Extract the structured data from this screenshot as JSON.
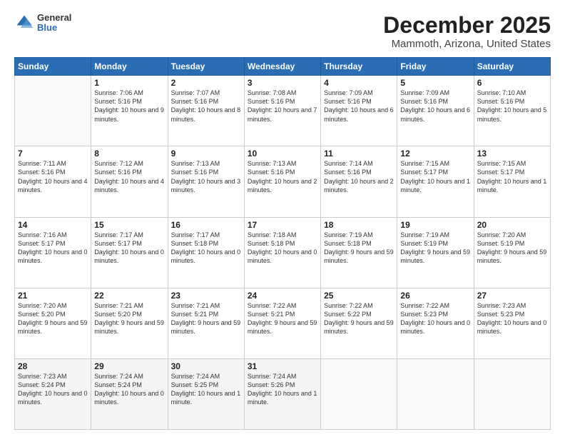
{
  "logo": {
    "general": "General",
    "blue": "Blue"
  },
  "title": "December 2025",
  "subtitle": "Mammoth, Arizona, United States",
  "days_header": [
    "Sunday",
    "Monday",
    "Tuesday",
    "Wednesday",
    "Thursday",
    "Friday",
    "Saturday"
  ],
  "weeks": [
    [
      {
        "num": "",
        "sunrise": "",
        "sunset": "",
        "daylight": ""
      },
      {
        "num": "1",
        "sunrise": "Sunrise: 7:06 AM",
        "sunset": "Sunset: 5:16 PM",
        "daylight": "Daylight: 10 hours and 9 minutes."
      },
      {
        "num": "2",
        "sunrise": "Sunrise: 7:07 AM",
        "sunset": "Sunset: 5:16 PM",
        "daylight": "Daylight: 10 hours and 8 minutes."
      },
      {
        "num": "3",
        "sunrise": "Sunrise: 7:08 AM",
        "sunset": "Sunset: 5:16 PM",
        "daylight": "Daylight: 10 hours and 7 minutes."
      },
      {
        "num": "4",
        "sunrise": "Sunrise: 7:09 AM",
        "sunset": "Sunset: 5:16 PM",
        "daylight": "Daylight: 10 hours and 6 minutes."
      },
      {
        "num": "5",
        "sunrise": "Sunrise: 7:09 AM",
        "sunset": "Sunset: 5:16 PM",
        "daylight": "Daylight: 10 hours and 6 minutes."
      },
      {
        "num": "6",
        "sunrise": "Sunrise: 7:10 AM",
        "sunset": "Sunset: 5:16 PM",
        "daylight": "Daylight: 10 hours and 5 minutes."
      }
    ],
    [
      {
        "num": "7",
        "sunrise": "Sunrise: 7:11 AM",
        "sunset": "Sunset: 5:16 PM",
        "daylight": "Daylight: 10 hours and 4 minutes."
      },
      {
        "num": "8",
        "sunrise": "Sunrise: 7:12 AM",
        "sunset": "Sunset: 5:16 PM",
        "daylight": "Daylight: 10 hours and 4 minutes."
      },
      {
        "num": "9",
        "sunrise": "Sunrise: 7:13 AM",
        "sunset": "Sunset: 5:16 PM",
        "daylight": "Daylight: 10 hours and 3 minutes."
      },
      {
        "num": "10",
        "sunrise": "Sunrise: 7:13 AM",
        "sunset": "Sunset: 5:16 PM",
        "daylight": "Daylight: 10 hours and 2 minutes."
      },
      {
        "num": "11",
        "sunrise": "Sunrise: 7:14 AM",
        "sunset": "Sunset: 5:16 PM",
        "daylight": "Daylight: 10 hours and 2 minutes."
      },
      {
        "num": "12",
        "sunrise": "Sunrise: 7:15 AM",
        "sunset": "Sunset: 5:17 PM",
        "daylight": "Daylight: 10 hours and 1 minute."
      },
      {
        "num": "13",
        "sunrise": "Sunrise: 7:15 AM",
        "sunset": "Sunset: 5:17 PM",
        "daylight": "Daylight: 10 hours and 1 minute."
      }
    ],
    [
      {
        "num": "14",
        "sunrise": "Sunrise: 7:16 AM",
        "sunset": "Sunset: 5:17 PM",
        "daylight": "Daylight: 10 hours and 0 minutes."
      },
      {
        "num": "15",
        "sunrise": "Sunrise: 7:17 AM",
        "sunset": "Sunset: 5:17 PM",
        "daylight": "Daylight: 10 hours and 0 minutes."
      },
      {
        "num": "16",
        "sunrise": "Sunrise: 7:17 AM",
        "sunset": "Sunset: 5:18 PM",
        "daylight": "Daylight: 10 hours and 0 minutes."
      },
      {
        "num": "17",
        "sunrise": "Sunrise: 7:18 AM",
        "sunset": "Sunset: 5:18 PM",
        "daylight": "Daylight: 10 hours and 0 minutes."
      },
      {
        "num": "18",
        "sunrise": "Sunrise: 7:19 AM",
        "sunset": "Sunset: 5:18 PM",
        "daylight": "Daylight: 9 hours and 59 minutes."
      },
      {
        "num": "19",
        "sunrise": "Sunrise: 7:19 AM",
        "sunset": "Sunset: 5:19 PM",
        "daylight": "Daylight: 9 hours and 59 minutes."
      },
      {
        "num": "20",
        "sunrise": "Sunrise: 7:20 AM",
        "sunset": "Sunset: 5:19 PM",
        "daylight": "Daylight: 9 hours and 59 minutes."
      }
    ],
    [
      {
        "num": "21",
        "sunrise": "Sunrise: 7:20 AM",
        "sunset": "Sunset: 5:20 PM",
        "daylight": "Daylight: 9 hours and 59 minutes."
      },
      {
        "num": "22",
        "sunrise": "Sunrise: 7:21 AM",
        "sunset": "Sunset: 5:20 PM",
        "daylight": "Daylight: 9 hours and 59 minutes."
      },
      {
        "num": "23",
        "sunrise": "Sunrise: 7:21 AM",
        "sunset": "Sunset: 5:21 PM",
        "daylight": "Daylight: 9 hours and 59 minutes."
      },
      {
        "num": "24",
        "sunrise": "Sunrise: 7:22 AM",
        "sunset": "Sunset: 5:21 PM",
        "daylight": "Daylight: 9 hours and 59 minutes."
      },
      {
        "num": "25",
        "sunrise": "Sunrise: 7:22 AM",
        "sunset": "Sunset: 5:22 PM",
        "daylight": "Daylight: 9 hours and 59 minutes."
      },
      {
        "num": "26",
        "sunrise": "Sunrise: 7:22 AM",
        "sunset": "Sunset: 5:23 PM",
        "daylight": "Daylight: 10 hours and 0 minutes."
      },
      {
        "num": "27",
        "sunrise": "Sunrise: 7:23 AM",
        "sunset": "Sunset: 5:23 PM",
        "daylight": "Daylight: 10 hours and 0 minutes."
      }
    ],
    [
      {
        "num": "28",
        "sunrise": "Sunrise: 7:23 AM",
        "sunset": "Sunset: 5:24 PM",
        "daylight": "Daylight: 10 hours and 0 minutes."
      },
      {
        "num": "29",
        "sunrise": "Sunrise: 7:24 AM",
        "sunset": "Sunset: 5:24 PM",
        "daylight": "Daylight: 10 hours and 0 minutes."
      },
      {
        "num": "30",
        "sunrise": "Sunrise: 7:24 AM",
        "sunset": "Sunset: 5:25 PM",
        "daylight": "Daylight: 10 hours and 1 minute."
      },
      {
        "num": "31",
        "sunrise": "Sunrise: 7:24 AM",
        "sunset": "Sunset: 5:26 PM",
        "daylight": "Daylight: 10 hours and 1 minute."
      },
      {
        "num": "",
        "sunrise": "",
        "sunset": "",
        "daylight": ""
      },
      {
        "num": "",
        "sunrise": "",
        "sunset": "",
        "daylight": ""
      },
      {
        "num": "",
        "sunrise": "",
        "sunset": "",
        "daylight": ""
      }
    ]
  ]
}
